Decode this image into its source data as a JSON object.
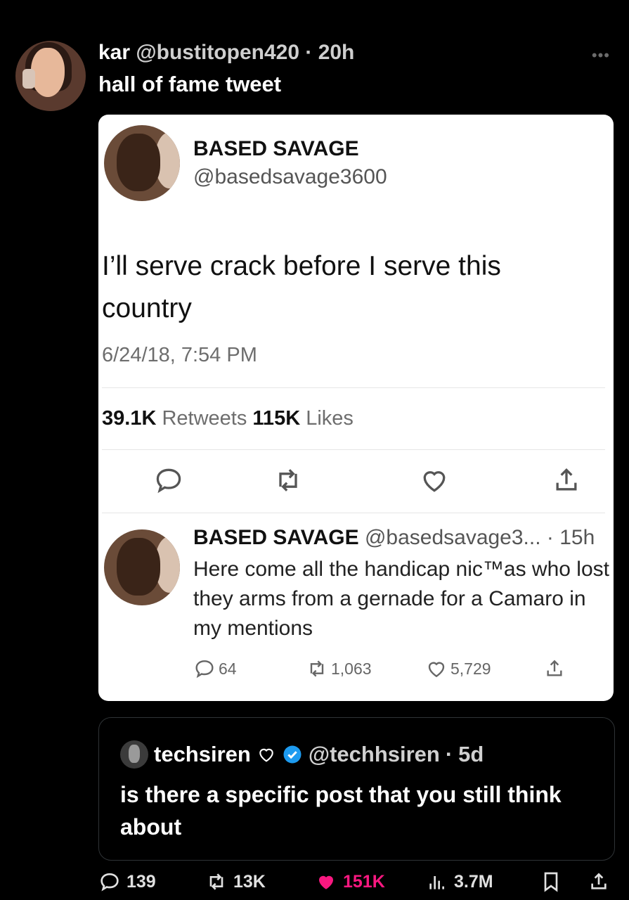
{
  "post": {
    "author_name": "kar",
    "author_handle": "@bustitopen420",
    "time": "20h",
    "caption": "hall of fame tweet",
    "more_icon": "more-dots-icon"
  },
  "screenshot": {
    "name": "BASED SAVAGE",
    "handle": "@basedsavage3600",
    "text": "I’ll serve crack before I serve this country",
    "date": "6/24/18, 7:54 PM",
    "retweets_count": "39.1K",
    "retweets_label": "Retweets",
    "likes_count": "115K",
    "likes_label": "Likes",
    "reply": {
      "name": "BASED SAVAGE",
      "handle": "@basedsavage3...",
      "time": "· 15h",
      "text": "Here come all the handicap niс™as who lost they arms from a gernade for a Camaro in my mentions",
      "replies": "64",
      "retweets": "1,063",
      "likes": "5,729"
    }
  },
  "quoted": {
    "name": "techsiren",
    "handle": "@techhsiren",
    "time": "5d",
    "text": "is there a specific post that you still think about",
    "verified_color": "#1d9bf0"
  },
  "actions": {
    "replies": "139",
    "reposts": "13K",
    "likes": "151K",
    "views": "3.7M",
    "like_color": "#f91880"
  }
}
